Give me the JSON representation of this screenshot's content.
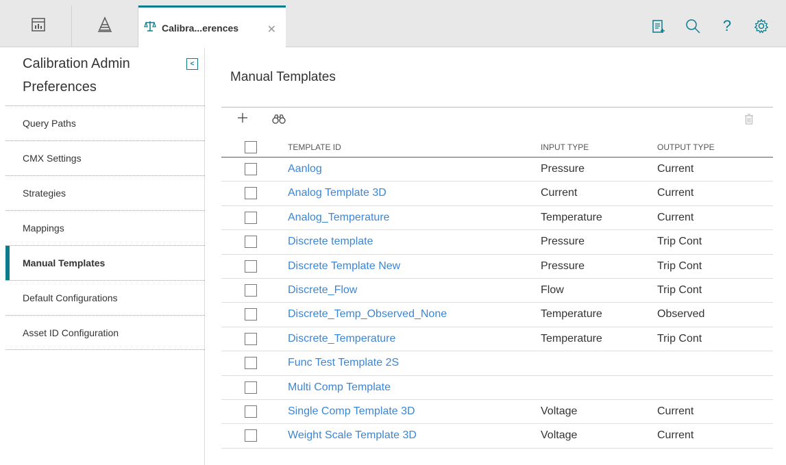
{
  "tabs": {
    "active_label": "Calibra...erences"
  },
  "sidebar": {
    "title": "Calibration Admin Preferences",
    "items": [
      {
        "label": "Query Paths"
      },
      {
        "label": "CMX Settings"
      },
      {
        "label": "Strategies"
      },
      {
        "label": "Mappings"
      },
      {
        "label": "Manual Templates",
        "active": true
      },
      {
        "label": "Default Configurations"
      },
      {
        "label": "Asset ID Configuration"
      }
    ]
  },
  "main": {
    "title": "Manual Templates",
    "columns": {
      "template_id": "TEMPLATE ID",
      "input_type": "INPUT TYPE",
      "output_type": "OUTPUT TYPE"
    },
    "rows": [
      {
        "id": "Aanlog",
        "input": "Pressure",
        "output": "Current"
      },
      {
        "id": "Analog Template 3D",
        "input": "Current",
        "output": "Current"
      },
      {
        "id": "Analog_Temperature",
        "input": "Temperature",
        "output": "Current"
      },
      {
        "id": "Discrete template",
        "input": "Pressure",
        "output": "Trip Cont"
      },
      {
        "id": "Discrete Template New",
        "input": "Pressure",
        "output": "Trip Cont"
      },
      {
        "id": "Discrete_Flow",
        "input": "Flow",
        "output": "Trip Cont"
      },
      {
        "id": "Discrete_Temp_Observed_None",
        "input": "Temperature",
        "output": "Observed"
      },
      {
        "id": "Discrete_Temperature",
        "input": "Temperature",
        "output": "Trip Cont"
      },
      {
        "id": "Func Test Template 2S",
        "input": "",
        "output": ""
      },
      {
        "id": "Multi Comp Template",
        "input": "",
        "output": ""
      },
      {
        "id": "Single Comp Template 3D",
        "input": "Voltage",
        "output": "Current"
      },
      {
        "id": "Weight Scale Template 3D",
        "input": "Voltage",
        "output": "Current"
      }
    ]
  },
  "colors": {
    "accent": "#0a7c8c",
    "link": "#3b86d4"
  },
  "icons": {
    "nav1": "dashboard-icon",
    "nav2": "asset-hierarchy-icon",
    "tab": "scale-balance-icon",
    "top": [
      "clipboard-add-icon",
      "search-icon",
      "help-icon",
      "gear-icon"
    ],
    "toolbar": [
      "plus-icon",
      "binoculars-icon",
      "trash-icon"
    ]
  }
}
